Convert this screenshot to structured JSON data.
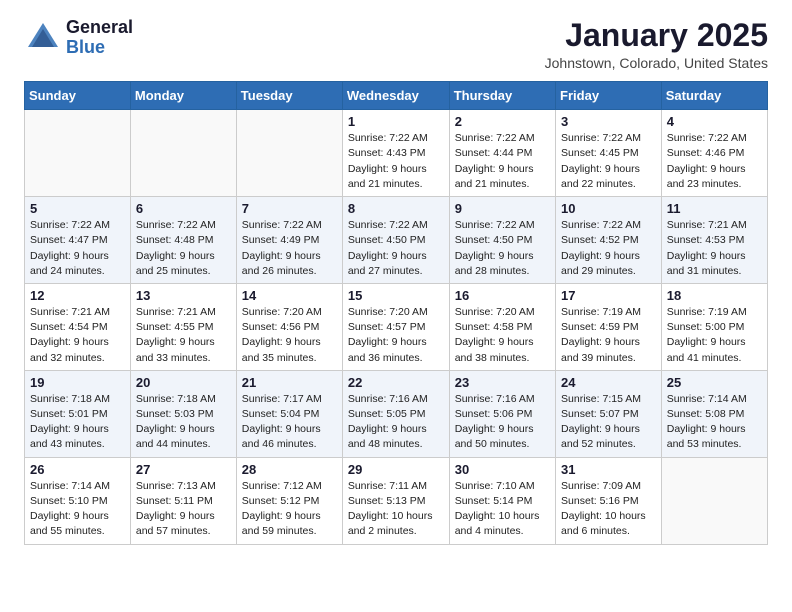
{
  "header": {
    "logo_general": "General",
    "logo_blue": "Blue",
    "month_title": "January 2025",
    "location": "Johnstown, Colorado, United States"
  },
  "days_of_week": [
    "Sunday",
    "Monday",
    "Tuesday",
    "Wednesday",
    "Thursday",
    "Friday",
    "Saturday"
  ],
  "weeks": [
    [
      {
        "day": "",
        "content": ""
      },
      {
        "day": "",
        "content": ""
      },
      {
        "day": "",
        "content": ""
      },
      {
        "day": "1",
        "content": "Sunrise: 7:22 AM\nSunset: 4:43 PM\nDaylight: 9 hours\nand 21 minutes."
      },
      {
        "day": "2",
        "content": "Sunrise: 7:22 AM\nSunset: 4:44 PM\nDaylight: 9 hours\nand 21 minutes."
      },
      {
        "day": "3",
        "content": "Sunrise: 7:22 AM\nSunset: 4:45 PM\nDaylight: 9 hours\nand 22 minutes."
      },
      {
        "day": "4",
        "content": "Sunrise: 7:22 AM\nSunset: 4:46 PM\nDaylight: 9 hours\nand 23 minutes."
      }
    ],
    [
      {
        "day": "5",
        "content": "Sunrise: 7:22 AM\nSunset: 4:47 PM\nDaylight: 9 hours\nand 24 minutes."
      },
      {
        "day": "6",
        "content": "Sunrise: 7:22 AM\nSunset: 4:48 PM\nDaylight: 9 hours\nand 25 minutes."
      },
      {
        "day": "7",
        "content": "Sunrise: 7:22 AM\nSunset: 4:49 PM\nDaylight: 9 hours\nand 26 minutes."
      },
      {
        "day": "8",
        "content": "Sunrise: 7:22 AM\nSunset: 4:50 PM\nDaylight: 9 hours\nand 27 minutes."
      },
      {
        "day": "9",
        "content": "Sunrise: 7:22 AM\nSunset: 4:50 PM\nDaylight: 9 hours\nand 28 minutes."
      },
      {
        "day": "10",
        "content": "Sunrise: 7:22 AM\nSunset: 4:52 PM\nDaylight: 9 hours\nand 29 minutes."
      },
      {
        "day": "11",
        "content": "Sunrise: 7:21 AM\nSunset: 4:53 PM\nDaylight: 9 hours\nand 31 minutes."
      }
    ],
    [
      {
        "day": "12",
        "content": "Sunrise: 7:21 AM\nSunset: 4:54 PM\nDaylight: 9 hours\nand 32 minutes."
      },
      {
        "day": "13",
        "content": "Sunrise: 7:21 AM\nSunset: 4:55 PM\nDaylight: 9 hours\nand 33 minutes."
      },
      {
        "day": "14",
        "content": "Sunrise: 7:20 AM\nSunset: 4:56 PM\nDaylight: 9 hours\nand 35 minutes."
      },
      {
        "day": "15",
        "content": "Sunrise: 7:20 AM\nSunset: 4:57 PM\nDaylight: 9 hours\nand 36 minutes."
      },
      {
        "day": "16",
        "content": "Sunrise: 7:20 AM\nSunset: 4:58 PM\nDaylight: 9 hours\nand 38 minutes."
      },
      {
        "day": "17",
        "content": "Sunrise: 7:19 AM\nSunset: 4:59 PM\nDaylight: 9 hours\nand 39 minutes."
      },
      {
        "day": "18",
        "content": "Sunrise: 7:19 AM\nSunset: 5:00 PM\nDaylight: 9 hours\nand 41 minutes."
      }
    ],
    [
      {
        "day": "19",
        "content": "Sunrise: 7:18 AM\nSunset: 5:01 PM\nDaylight: 9 hours\nand 43 minutes."
      },
      {
        "day": "20",
        "content": "Sunrise: 7:18 AM\nSunset: 5:03 PM\nDaylight: 9 hours\nand 44 minutes."
      },
      {
        "day": "21",
        "content": "Sunrise: 7:17 AM\nSunset: 5:04 PM\nDaylight: 9 hours\nand 46 minutes."
      },
      {
        "day": "22",
        "content": "Sunrise: 7:16 AM\nSunset: 5:05 PM\nDaylight: 9 hours\nand 48 minutes."
      },
      {
        "day": "23",
        "content": "Sunrise: 7:16 AM\nSunset: 5:06 PM\nDaylight: 9 hours\nand 50 minutes."
      },
      {
        "day": "24",
        "content": "Sunrise: 7:15 AM\nSunset: 5:07 PM\nDaylight: 9 hours\nand 52 minutes."
      },
      {
        "day": "25",
        "content": "Sunrise: 7:14 AM\nSunset: 5:08 PM\nDaylight: 9 hours\nand 53 minutes."
      }
    ],
    [
      {
        "day": "26",
        "content": "Sunrise: 7:14 AM\nSunset: 5:10 PM\nDaylight: 9 hours\nand 55 minutes."
      },
      {
        "day": "27",
        "content": "Sunrise: 7:13 AM\nSunset: 5:11 PM\nDaylight: 9 hours\nand 57 minutes."
      },
      {
        "day": "28",
        "content": "Sunrise: 7:12 AM\nSunset: 5:12 PM\nDaylight: 9 hours\nand 59 minutes."
      },
      {
        "day": "29",
        "content": "Sunrise: 7:11 AM\nSunset: 5:13 PM\nDaylight: 10 hours\nand 2 minutes."
      },
      {
        "day": "30",
        "content": "Sunrise: 7:10 AM\nSunset: 5:14 PM\nDaylight: 10 hours\nand 4 minutes."
      },
      {
        "day": "31",
        "content": "Sunrise: 7:09 AM\nSunset: 5:16 PM\nDaylight: 10 hours\nand 6 minutes."
      },
      {
        "day": "",
        "content": ""
      }
    ]
  ]
}
